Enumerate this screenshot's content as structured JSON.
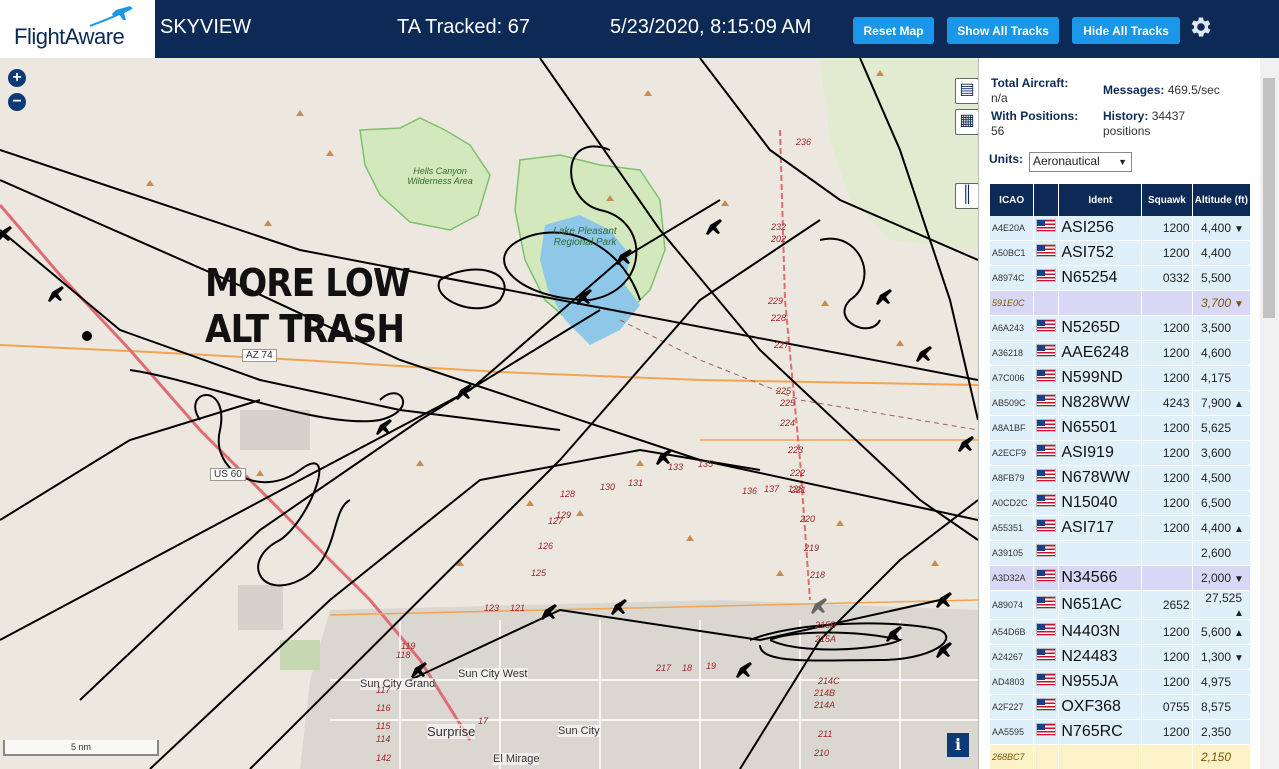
{
  "header": {
    "logo": "FlightAware",
    "app_name": "SKYVIEW",
    "tracked": "TA Tracked: 67",
    "datetime": "5/23/2020, 8:15:09 AM",
    "buttons": {
      "reset": "Reset Map",
      "show_all": "Show All Tracks",
      "hide_all": "Hide All Tracks"
    },
    "settings_icon": "gear-icon"
  },
  "map": {
    "annotation_line1": "MORE LOW",
    "annotation_line2": "ALT TRASH",
    "scale": "5 nm",
    "places": {
      "hells_canyon": "Hells Canyon Wilderness Area",
      "lake_pleasant": "Lake Pleasant Regional Park",
      "sun_city_grand": "Sun City Grand",
      "sun_city_west": "Sun City West",
      "surprise": "Surprise",
      "sun_city": "Sun City",
      "el_mirage": "El Mirage"
    },
    "roads": {
      "az74": "AZ 74",
      "us60": "US 60"
    },
    "route_numbers": [
      "236",
      "232",
      "202",
      "229",
      "228",
      "227",
      "225",
      "225",
      "224",
      "223",
      "222",
      "221",
      "220",
      "219",
      "218",
      "215B",
      "215A",
      "214C",
      "214B",
      "214A",
      "211",
      "210",
      "217",
      "133",
      "135",
      "136",
      "137",
      "138",
      "128",
      "130",
      "131",
      "129",
      "127",
      "126",
      "125",
      "123",
      "121",
      "119",
      "118",
      "117",
      "116",
      "115",
      "114",
      "142",
      "17",
      "18",
      "19"
    ],
    "colors": {
      "road_orange": "#f2a452",
      "road_red": "#e06b72",
      "water": "#8fc7e8",
      "park": "#cfe6b5",
      "track": "#000000"
    }
  },
  "panel": {
    "total_aircraft_label": "Total Aircraft:",
    "total_aircraft_value": "n/a",
    "with_positions_label": "With Positions:",
    "with_positions_value": "56",
    "messages_label": "Messages:",
    "messages_value": "469.5/sec",
    "history_label": "History:",
    "history_value": "34437",
    "history_unit": "positions",
    "units_label": "Units:",
    "units_value": "Aeronautical",
    "columns": [
      "ICAO",
      "",
      "Ident",
      "Squawk",
      "Altitude (ft)"
    ],
    "rows": [
      {
        "icao": "A4E20A",
        "flag": true,
        "ident": "ASI256",
        "squawk": "1200",
        "alt": "4,400",
        "trend": "▼",
        "style": ""
      },
      {
        "icao": "A50BC1",
        "flag": true,
        "ident": "ASI752",
        "squawk": "1200",
        "alt": "4,400",
        "trend": "",
        "style": ""
      },
      {
        "icao": "A8974C",
        "flag": true,
        "ident": "N65254",
        "squawk": "0332",
        "alt": "5,500",
        "trend": "",
        "style": ""
      },
      {
        "icao": "591E0C",
        "flag": false,
        "ident": "",
        "squawk": "",
        "alt": "3,700",
        "trend": "▼",
        "style": "sel italic"
      },
      {
        "icao": "A6A243",
        "flag": true,
        "ident": "N5265D",
        "squawk": "1200",
        "alt": "3,500",
        "trend": "",
        "style": ""
      },
      {
        "icao": "A36218",
        "flag": true,
        "ident": "AAE6248",
        "squawk": "1200",
        "alt": "4,600",
        "trend": "",
        "style": ""
      },
      {
        "icao": "A7C006",
        "flag": true,
        "ident": "N599ND",
        "squawk": "1200",
        "alt": "4,175",
        "trend": "",
        "style": ""
      },
      {
        "icao": "AB509C",
        "flag": true,
        "ident": "N828WW",
        "squawk": "4243",
        "alt": "7,900",
        "trend": "▲",
        "style": ""
      },
      {
        "icao": "A8A1BF",
        "flag": true,
        "ident": "N65501",
        "squawk": "1200",
        "alt": "5,625",
        "trend": "",
        "style": ""
      },
      {
        "icao": "A2ECF9",
        "flag": true,
        "ident": "ASI919",
        "squawk": "1200",
        "alt": "3,600",
        "trend": "",
        "style": ""
      },
      {
        "icao": "A8FB79",
        "flag": true,
        "ident": "N678WW",
        "squawk": "1200",
        "alt": "4,500",
        "trend": "",
        "style": ""
      },
      {
        "icao": "A0CD2C",
        "flag": true,
        "ident": "N15040",
        "squawk": "1200",
        "alt": "6,500",
        "trend": "",
        "style": ""
      },
      {
        "icao": "A55351",
        "flag": true,
        "ident": "ASI717",
        "squawk": "1200",
        "alt": "4,400",
        "trend": "▲",
        "style": ""
      },
      {
        "icao": "A39105",
        "flag": true,
        "ident": "",
        "squawk": "",
        "alt": "2,600",
        "trend": "",
        "style": ""
      },
      {
        "icao": "A3D32A",
        "flag": true,
        "ident": "N34566",
        "squawk": "",
        "alt": "2,000",
        "trend": "▼",
        "style": "sel"
      },
      {
        "icao": "A89074",
        "flag": true,
        "ident": "N651AC",
        "squawk": "2652",
        "alt": "27,525",
        "trend": "▲",
        "style": ""
      },
      {
        "icao": "A54D6B",
        "flag": true,
        "ident": "N4403N",
        "squawk": "1200",
        "alt": "5,600",
        "trend": "▲",
        "style": ""
      },
      {
        "icao": "A24267",
        "flag": true,
        "ident": "N24483",
        "squawk": "1200",
        "alt": "1,300",
        "trend": "▼",
        "style": ""
      },
      {
        "icao": "AD4803",
        "flag": true,
        "ident": "N955JA",
        "squawk": "1200",
        "alt": "4,975",
        "trend": "",
        "style": ""
      },
      {
        "icao": "A2F227",
        "flag": true,
        "ident": "OXF368",
        "squawk": "0755",
        "alt": "8,575",
        "trend": "",
        "style": ""
      },
      {
        "icao": "AA5595",
        "flag": true,
        "ident": "N765RC",
        "squawk": "1200",
        "alt": "2,350",
        "trend": "",
        "style": ""
      },
      {
        "icao": "268BC7",
        "flag": false,
        "ident": "",
        "squawk": "",
        "alt": "2,150",
        "trend": "",
        "style": "mlat italic"
      }
    ]
  }
}
